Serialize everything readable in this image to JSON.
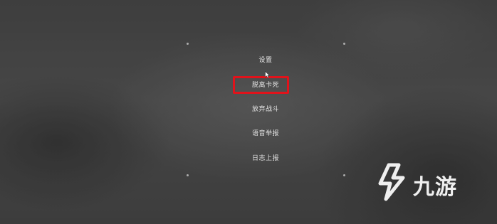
{
  "menu": {
    "items": [
      {
        "label": "设置"
      },
      {
        "label": "脱离卡死"
      },
      {
        "label": "放弃战斗"
      },
      {
        "label": "语音举报"
      },
      {
        "label": "日志上报"
      }
    ],
    "highlighted_index": 1
  },
  "watermark": {
    "text": "九游",
    "icon": "jiuyou-logo-icon"
  },
  "colors": {
    "highlight_border": "#e0131b",
    "menu_text": "#e2e2e2",
    "background": "#4b4b4b"
  }
}
